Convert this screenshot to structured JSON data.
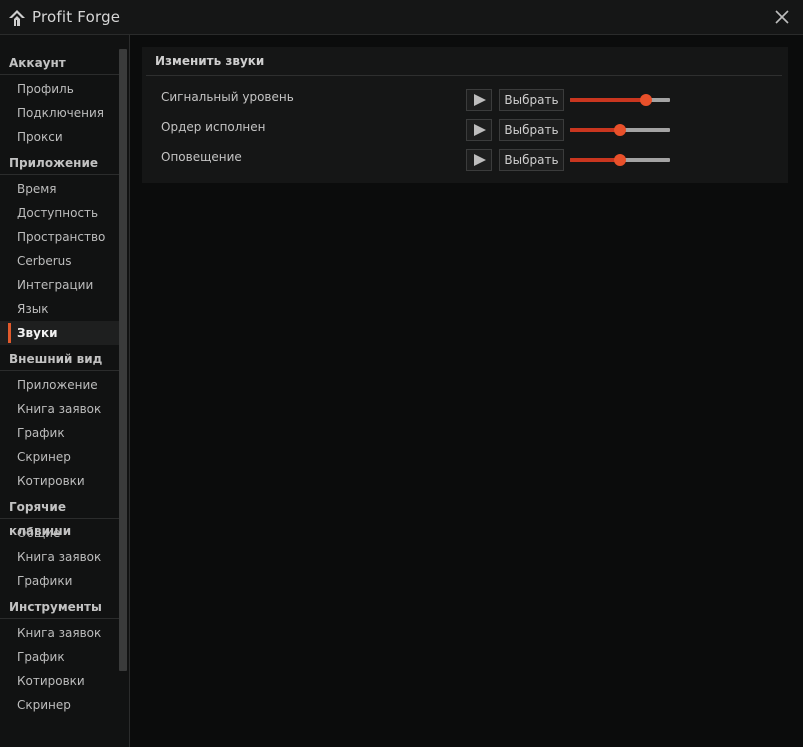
{
  "window": {
    "title": "Profit Forge"
  },
  "sidebar": {
    "sections": [
      {
        "label": "Аккаунт",
        "items": [
          {
            "label": "Профиль"
          },
          {
            "label": "Подключения"
          },
          {
            "label": "Прокси"
          }
        ]
      },
      {
        "label": "Приложение",
        "items": [
          {
            "label": "Время"
          },
          {
            "label": "Доступность"
          },
          {
            "label": "Пространство"
          },
          {
            "label": "Cerberus"
          },
          {
            "label": "Интеграции"
          },
          {
            "label": "Язык"
          },
          {
            "label": "Звуки",
            "active": true
          }
        ]
      },
      {
        "label": "Внешний вид",
        "items": [
          {
            "label": "Приложение"
          },
          {
            "label": "Книга заявок"
          },
          {
            "label": "График"
          },
          {
            "label": "Скринер"
          },
          {
            "label": "Котировки"
          }
        ]
      },
      {
        "label": "Горячие клавиши",
        "items": [
          {
            "label": "Общие"
          },
          {
            "label": "Книга заявок"
          },
          {
            "label": "Графики"
          }
        ]
      },
      {
        "label": "Инструменты",
        "items": [
          {
            "label": "Книга заявок"
          },
          {
            "label": "График"
          },
          {
            "label": "Котировки"
          },
          {
            "label": "Скринер"
          }
        ]
      }
    ]
  },
  "sounds": {
    "title": "Изменить звуки",
    "rows": [
      {
        "label": "Сигнальный уровень",
        "choose_label": "Выбрать",
        "volume": 0.76
      },
      {
        "label": "Ордер исполнен",
        "choose_label": "Выбрать",
        "volume": 0.5
      },
      {
        "label": "Оповещение",
        "choose_label": "Выбрать",
        "volume": 0.5
      }
    ]
  },
  "colors": {
    "accent": "#e8502a",
    "slider_fill": "#c9361f",
    "slider_track": "#a3a3a3"
  },
  "icons": {
    "logo": "profit-forge-logo-icon",
    "close": "close-icon",
    "play": "play-icon"
  }
}
